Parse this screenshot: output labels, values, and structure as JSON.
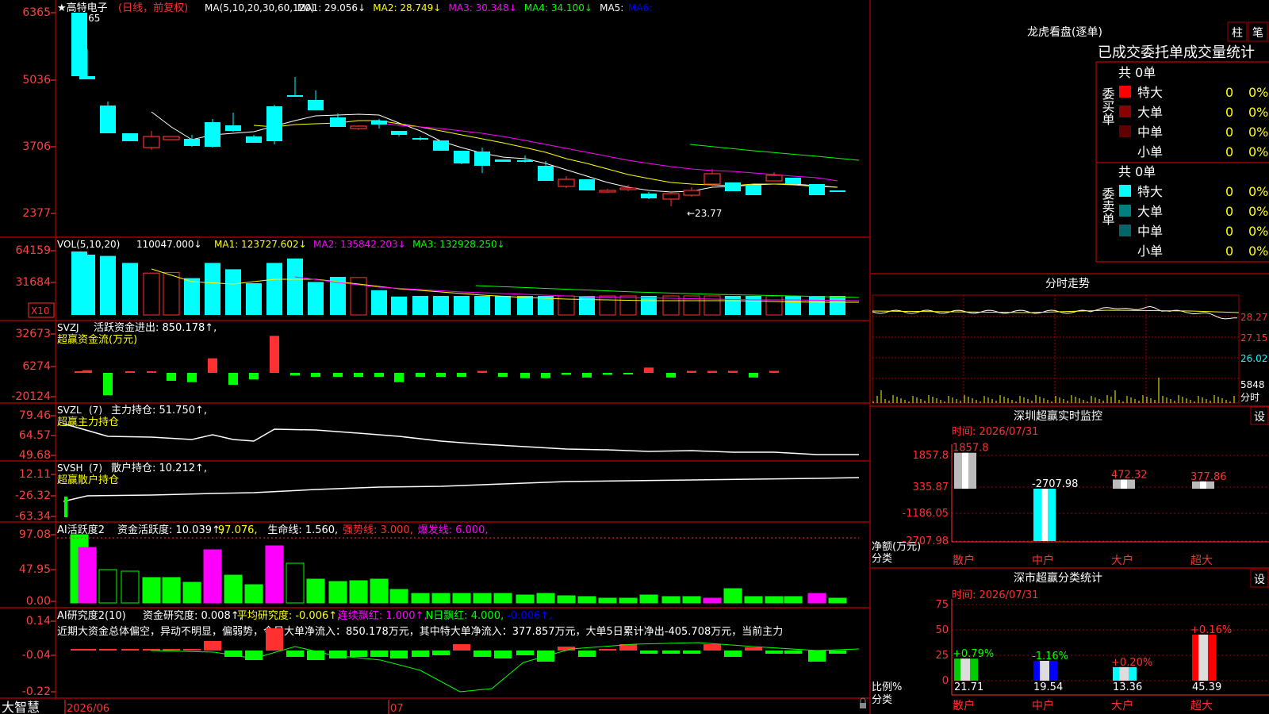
{
  "colors": {
    "bg": "#000000",
    "frame": "#b00000",
    "up": "#ff3030",
    "down": "#00ffff",
    "green": "#00ff00",
    "magenta": "#ff00ff",
    "white": "#ffffff",
    "yellow": "#ffff00",
    "axis_text": "#ff4040"
  },
  "kline": {
    "title": "★高特电子",
    "period": "(日线，前复权)",
    "ma_label": "MA(5,10,20,30,60,120)",
    "ma": [
      {
        "text": "MA1: 29.056↓",
        "color": "#ffffff"
      },
      {
        "text": "MA2: 28.749↓",
        "color": "#ffff00"
      },
      {
        "text": "MA3: 30.348↓",
        "color": "#ff00ff"
      },
      {
        "text": "MA4: 34.100↓",
        "color": "#00ff00"
      },
      {
        "text": "MA5:",
        "color": "#ffffff"
      },
      {
        "text": "MA6:",
        "color": "#0000ff"
      }
    ],
    "high_note": "63.65",
    "low_note": "←23.77",
    "y_ticks": [
      "6365",
      "5036",
      "3706",
      "2377"
    ]
  },
  "vol": {
    "title": "VOL(5,10,20)",
    "value": "110047.000↓",
    "ma": [
      {
        "text": "MA1: 123727.602↓",
        "color": "#ffff00"
      },
      {
        "text": "MA2: 135842.203↓",
        "color": "#ff00ff"
      },
      {
        "text": "MA3: 132928.250↓",
        "color": "#00ff00"
      }
    ],
    "y_ticks": [
      "64159",
      "31684"
    ],
    "unit": "X10",
    "values": [
      100,
      95,
      93,
      82,
      66,
      67,
      58,
      82,
      72,
      50,
      82,
      89,
      52,
      60,
      59,
      39,
      29,
      30,
      30,
      30,
      30,
      30,
      30,
      30,
      30,
      30,
      30,
      30,
      30,
      30,
      30,
      30,
      30,
      30,
      30,
      30,
      30,
      30,
      30,
      30,
      30
    ]
  },
  "svzj": {
    "title": "SVZJ",
    "label": "活跃资金进出: 850.178↑,",
    "sub": "超赢资金流(万元)",
    "y_ticks": [
      "32673",
      "6274",
      "-20124"
    ],
    "values": [
      0,
      2000,
      -17000,
      600,
      300,
      -6000,
      -7000,
      11000,
      -9000,
      -5000,
      28000,
      -2000,
      -3000,
      -3000,
      -3000,
      -3000,
      -7000,
      -3000,
      -3000,
      -3000,
      1500,
      -3000,
      -4000,
      -4000,
      -1500,
      -3500,
      -1500,
      -1200,
      4000,
      -3500,
      1500,
      1500,
      1500,
      -3500,
      1500
    ]
  },
  "svzl": {
    "title": "SVZL",
    "param": "(7)",
    "label": "主力持仓: 51.750↑,",
    "sub": "超赢主力持仓",
    "y_ticks": [
      "79.46",
      "64.57",
      "49.68"
    ]
  },
  "svsh": {
    "title": "SVSH",
    "param": "(7)",
    "label": "散户持仓: 10.212↑,",
    "sub": "超赢散户持仓",
    "y_ticks": [
      "12.11",
      "-26.32",
      "-63.34"
    ]
  },
  "ai_active": {
    "title": "AI活跃度2",
    "parts": [
      {
        "text": "资金活跃度: 10.039↑,",
        "color": "#ffffff"
      },
      {
        "text": "97.076,",
        "color": "#ffff00"
      },
      {
        "text": "生命线: 1.560,",
        "color": "#ffffff"
      },
      {
        "text": "强势线: 3.000,",
        "color": "#ff3030"
      },
      {
        "text": "爆发线: 6.000,",
        "color": "#ff00ff"
      }
    ],
    "y_ticks": [
      "97.08",
      "47.95",
      "0.00"
    ]
  },
  "ai_research": {
    "title": "AI研究度2(10)",
    "parts": [
      {
        "text": "资金研究度: 0.008↑,",
        "color": "#ffffff"
      },
      {
        "text": "平均研究度: -0.006↑,",
        "color": "#ffff00"
      },
      {
        "text": "连续飘红: 1.000↑,",
        "color": "#ff00ff"
      },
      {
        "text": "N日飘红: 4.000,",
        "color": "#00ff00"
      },
      {
        "text": "-0.006↑,",
        "color": "#0000ff"
      }
    ],
    "comment": "近期大资金总体偏空，异动不明显，偏弱势，今日大单净流入：850.178万元，其中特大单净流入：377.857万元，大单5日累计净出-405.708万元，当前主力",
    "y_ticks": [
      "0.14",
      "-0.04",
      "-0.22"
    ]
  },
  "bottom_bar": {
    "brand": "大智慧",
    "date1": "2026/06",
    "date2": "07"
  },
  "dragon": {
    "title": "龙虎看盘(逐单)",
    "btn1": "柱",
    "btn2": "笔",
    "subtitle": "已成交委托单成交量统计",
    "buy_label": "委买单",
    "sell_label": "委卖单",
    "buy_total": "共 0单",
    "sell_total": "共 0单",
    "buy_rows": [
      {
        "name": "特大",
        "count": "0",
        "pct": "0%",
        "color": "#ff0000"
      },
      {
        "name": "大单",
        "count": "0",
        "pct": "0%",
        "color": "#8b0000"
      },
      {
        "name": "中单",
        "count": "0",
        "pct": "0%",
        "color": "#600000"
      },
      {
        "name": "小单",
        "count": "0",
        "pct": "0%",
        "color": ""
      }
    ],
    "sell_rows": [
      {
        "name": "特大",
        "count": "0",
        "pct": "0%",
        "color": "#00ffff"
      },
      {
        "name": "大单",
        "count": "0",
        "pct": "0%",
        "color": "#008080"
      },
      {
        "name": "中单",
        "count": "0",
        "pct": "0%",
        "color": "#006666"
      },
      {
        "name": "小单",
        "count": "0",
        "pct": "0%",
        "color": ""
      }
    ]
  },
  "intraday": {
    "title": "分时走势",
    "y_ticks": [
      "28.27",
      "27.15",
      "26.02"
    ],
    "vol_tick": "5848",
    "vol_unit": "分时"
  },
  "monitor": {
    "title": "深圳超赢实时监控",
    "settings": "设",
    "time": "时间: 2026/07/31",
    "y_ticks": [
      "1857.8",
      "335.87",
      "-1186.05",
      "-2707.98"
    ],
    "axis_label_1": "净额(万元)",
    "axis_label_2": "分类",
    "bars": [
      {
        "label": "1857.8",
        "value": 1857.8,
        "category": "散户"
      },
      {
        "label": "-2707.98",
        "value": -2707.98,
        "category": "中户"
      },
      {
        "label": "472.32",
        "value": 472.32,
        "category": "大户"
      },
      {
        "label": "377.86",
        "value": 377.86,
        "category": "超大"
      }
    ]
  },
  "classify": {
    "title": "深市超赢分类统计",
    "settings": "设",
    "time": "时间: 2026/07/31",
    "y_ticks": [
      "75",
      "50",
      "25",
      "0"
    ],
    "axis_label_1": "比例%",
    "axis_label_2": "分类",
    "bars": [
      {
        "pct": "+0.79%",
        "value": 21.71,
        "label": "21.71",
        "category": "散户",
        "pct_color": "#00ff00"
      },
      {
        "pct": "-1.16%",
        "value": 19.54,
        "label": "19.54",
        "category": "中户",
        "pct_color": "#00ff00"
      },
      {
        "pct": "+0.20%",
        "value": 13.36,
        "label": "13.36",
        "category": "大户",
        "pct_color": "#ff3030"
      },
      {
        "pct": "+0.16%",
        "value": 45.39,
        "label": "45.39",
        "category": "超大",
        "pct_color": "#ff3030"
      }
    ]
  }
}
